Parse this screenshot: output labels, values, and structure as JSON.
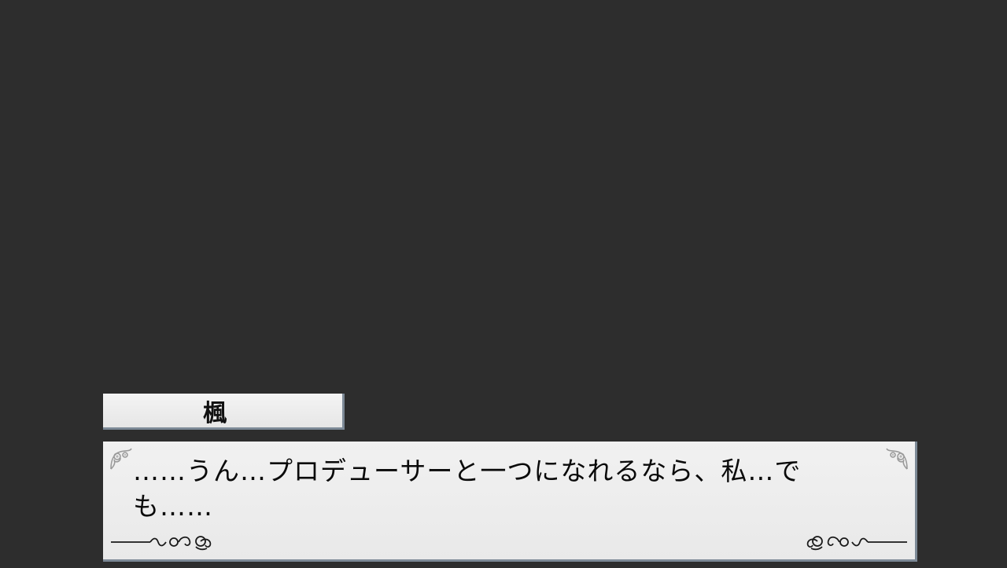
{
  "speaker": {
    "name": "楓"
  },
  "dialogue": {
    "text": "……うん…プロデューサーと一つになれるなら、私…でも……"
  },
  "colors": {
    "background": "#2d2d2d",
    "box_fill": "#efefef",
    "box_edge": "#7c8996",
    "text": "#0a0a0a"
  },
  "icons": {
    "corner": "ornament-corner-icon",
    "flourish": "scroll-flourish-icon"
  }
}
